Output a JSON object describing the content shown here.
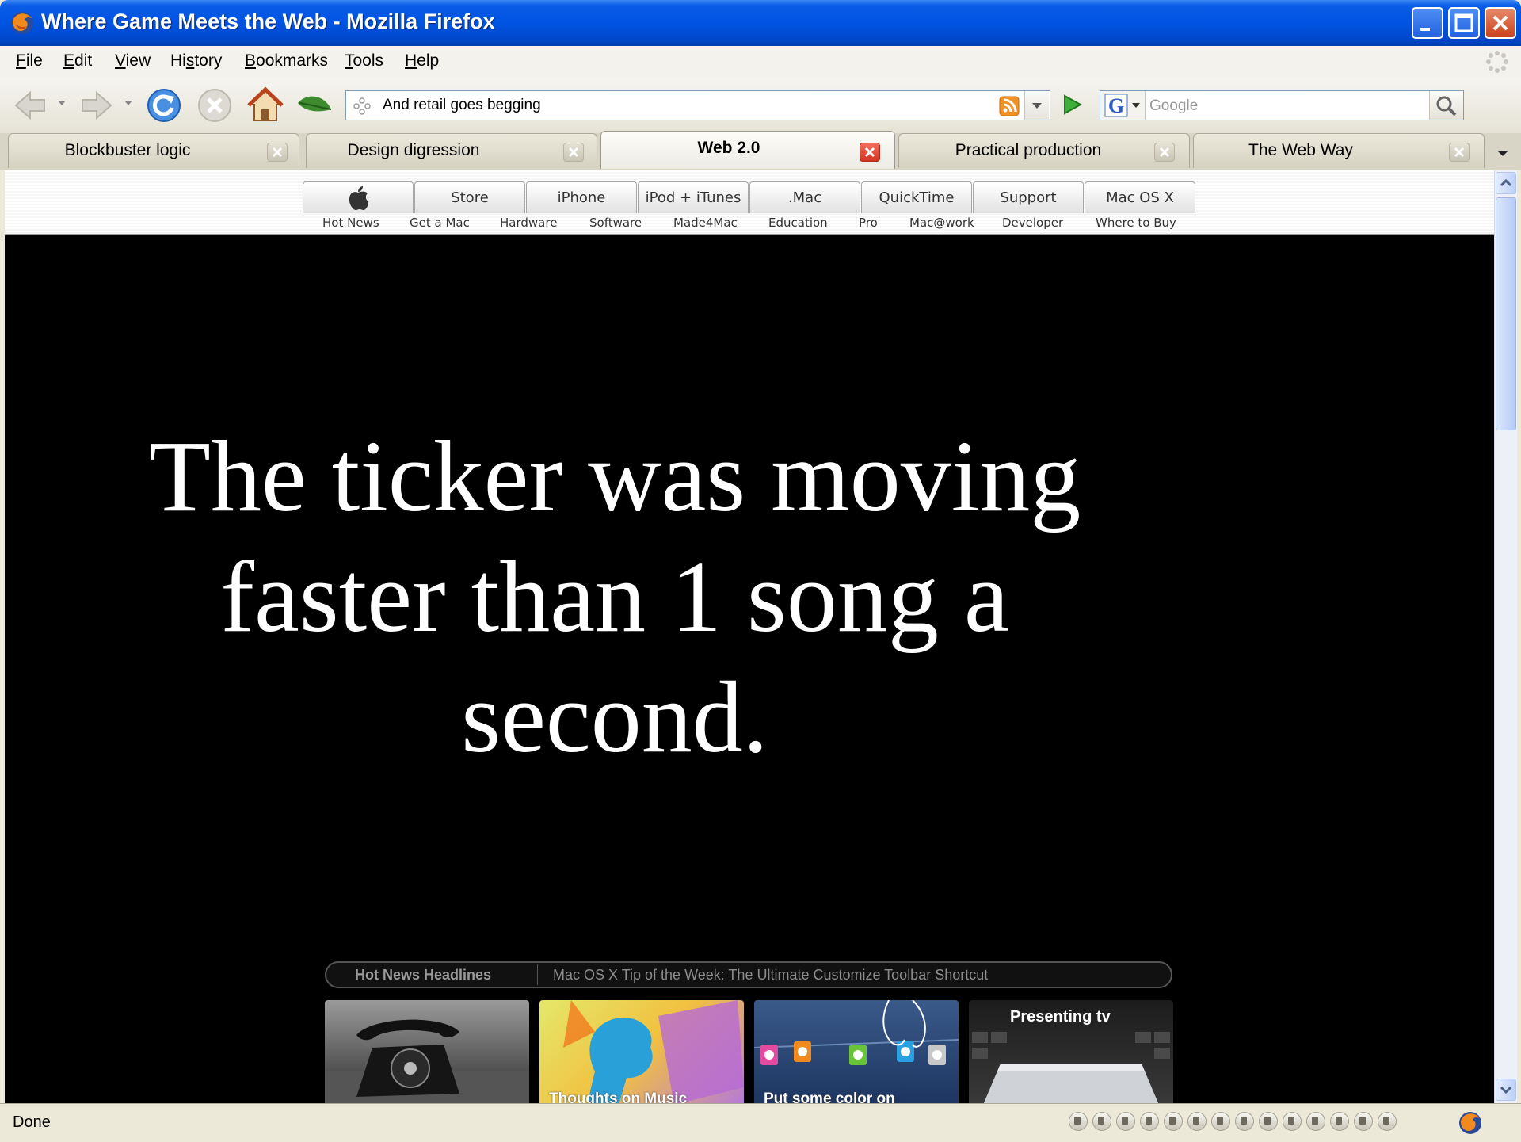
{
  "window": {
    "title": "Where Game Meets the Web - Mozilla Firefox"
  },
  "menu": {
    "items": [
      {
        "label": "File",
        "u": "F",
        "rest": "ile"
      },
      {
        "label": "Edit",
        "u": "E",
        "rest": "dit"
      },
      {
        "label": "View",
        "u": "V",
        "rest": "iew"
      },
      {
        "label": "History",
        "pre": "Hi",
        "u": "s",
        "rest": "tory"
      },
      {
        "label": "Bookmarks",
        "u": "B",
        "rest": "ookmarks"
      },
      {
        "label": "Tools",
        "u": "T",
        "rest": "ools"
      },
      {
        "label": "Help",
        "u": "H",
        "rest": "elp"
      }
    ]
  },
  "navbar": {
    "url": "And retail goes begging",
    "search_placeholder": "Google"
  },
  "tabs": [
    {
      "label": "Blockbuster logic",
      "active": false
    },
    {
      "label": "Design digression",
      "active": false
    },
    {
      "label": "Web 2.0",
      "active": true
    },
    {
      "label": "Practical production",
      "active": false
    },
    {
      "label": "The Web Way",
      "active": false
    }
  ],
  "apple_nav": {
    "tabs": [
      "Store",
      "iPhone",
      "iPod + iTunes",
      ".Mac",
      "QuickTime",
      "Support",
      "Mac OS X"
    ],
    "sub_links": [
      "Hot News",
      "Get a Mac",
      "Hardware",
      "Software",
      "Made4Mac",
      "Education",
      "Pro",
      "Mac@work",
      "Developer",
      "Where to Buy"
    ]
  },
  "slide": {
    "headline": "The ticker was moving faster than 1 song a second."
  },
  "news": {
    "label": "Hot News Headlines",
    "headline": "Mac OS X Tip of the Week: The Ultimate Customize Toolbar Shortcut"
  },
  "promos": [
    {
      "name": "telephone",
      "caption": ""
    },
    {
      "name": "thoughts-on-music",
      "caption": "Thoughts on Music"
    },
    {
      "name": "shuffle-colors",
      "caption": "Put some color on"
    },
    {
      "name": "apple-tv",
      "caption": "Presenting  tv"
    }
  ],
  "status": {
    "text": "Done"
  },
  "colors": {
    "titlebar": "#0054e3",
    "chrome": "#ece9d8",
    "content_bg": "#000000",
    "headline": "#ffffff"
  }
}
